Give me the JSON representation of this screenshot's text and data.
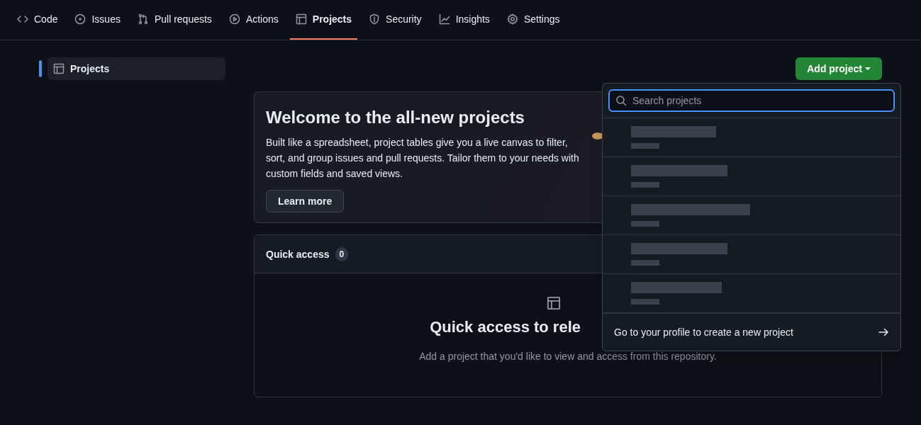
{
  "tabs": [
    {
      "label": "Code",
      "selected": false
    },
    {
      "label": "Issues",
      "selected": false
    },
    {
      "label": "Pull requests",
      "selected": false
    },
    {
      "label": "Actions",
      "selected": false
    },
    {
      "label": "Projects",
      "selected": true
    },
    {
      "label": "Security",
      "selected": false
    },
    {
      "label": "Insights",
      "selected": false
    },
    {
      "label": "Settings",
      "selected": false
    }
  ],
  "sidebar": {
    "items": [
      {
        "label": "Projects",
        "selected": true
      }
    ]
  },
  "add_button": {
    "label": "Add project"
  },
  "welcome": {
    "title": "Welcome to the all-new projects",
    "body": "Built like a spreadsheet, project tables give you a live canvas to filter, sort, and group issues and pull requests. Tailor them to your needs with custom fields and saved views.",
    "button": "Learn more"
  },
  "quick_access": {
    "title": "Quick access",
    "count": "0",
    "empty_title": "Quick access to rele",
    "empty_text": "Add a project that you'd like to view and access from this repository."
  },
  "dropdown": {
    "search": {
      "placeholder": "Search projects"
    },
    "items": [
      {
        "kind": "redacted"
      },
      {
        "kind": "redacted"
      },
      {
        "kind": "redacted"
      },
      {
        "kind": "redacted"
      },
      {
        "kind": "redacted"
      }
    ],
    "footer": "Go to your profile to create a new project"
  }
}
